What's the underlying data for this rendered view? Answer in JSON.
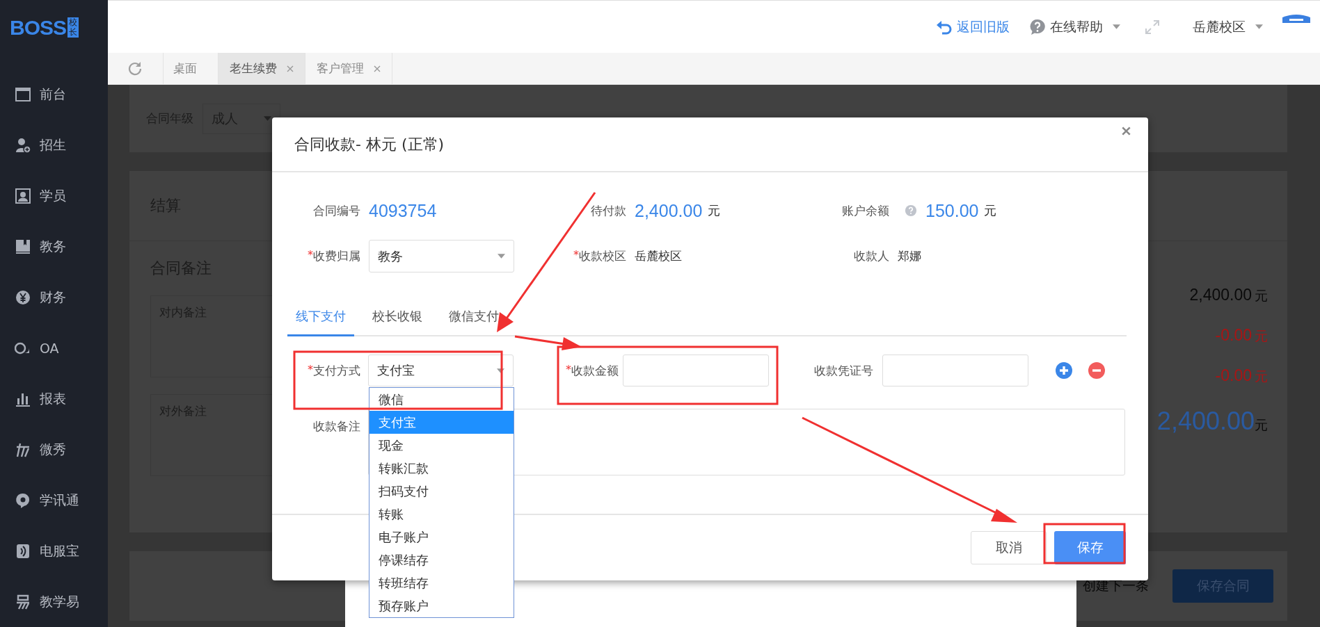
{
  "app": {
    "logo": "BOSS",
    "logo_badge": "校长"
  },
  "top_bar": {
    "back_link": "返回旧版",
    "help": "在线帮助",
    "campus": "岳麓校区"
  },
  "tabs": [
    {
      "label": "桌面",
      "selected": false,
      "closable": false
    },
    {
      "label": "老生续费",
      "selected": true,
      "closable": true
    },
    {
      "label": "客户管理",
      "selected": false,
      "closable": true
    }
  ],
  "sidebar": {
    "items": [
      {
        "label": "前台",
        "kind": "window"
      },
      {
        "label": "招生",
        "kind": "user-add"
      },
      {
        "label": "学员",
        "kind": "contact"
      },
      {
        "label": "教务",
        "kind": "book"
      },
      {
        "label": "财务",
        "kind": "yen"
      },
      {
        "label": "OA",
        "kind": "oa"
      },
      {
        "label": "报表",
        "kind": "chart"
      },
      {
        "label": "微秀",
        "kind": "strokes"
      },
      {
        "label": "学讯通",
        "kind": "pin"
      },
      {
        "label": "电服宝",
        "kind": "phone"
      },
      {
        "label": "教学易",
        "kind": "wave"
      }
    ]
  },
  "background": {
    "grade_label": "合同年级",
    "grade_value": "成人",
    "settlement_title": "结算",
    "remarks_title": "合同备注",
    "internal_remark_placeholder": "对内备注",
    "external_remark_placeholder": "对外备注",
    "amounts": [
      {
        "value": "2,400.00",
        "unit": "元",
        "kind": "normal"
      },
      {
        "value": "-0.00",
        "unit": "元",
        "kind": "negative"
      },
      {
        "value": "-0.00",
        "unit": "元",
        "kind": "negative"
      },
      {
        "value": "2,400.00",
        "unit": "元",
        "kind": "total"
      }
    ],
    "next_label": "创建下一条",
    "save_contract": "保存合同"
  },
  "dialog": {
    "title": "合同收款- 林元 (正常)",
    "info": [
      {
        "label": "合同编号",
        "value": "4093754",
        "help": false
      },
      {
        "label": "待付款",
        "value": "2,400.00",
        "unit": "元",
        "help": false
      },
      {
        "label": "账户余额",
        "value": "150.00",
        "unit": "元",
        "help": true
      }
    ],
    "fields": [
      {
        "label": "收费归属",
        "required_mark": "*",
        "value": "教务",
        "kind": "select"
      },
      {
        "label": "收款校区",
        "required_mark": "*",
        "value": "岳麓校区",
        "kind": "text"
      },
      {
        "label": "收款人",
        "value": "郑娜",
        "kind": "text"
      }
    ],
    "pay_tabs": [
      {
        "label": "线下支付",
        "selected": true
      },
      {
        "label": "校长收银",
        "selected": false
      },
      {
        "label": "微信支付",
        "selected": false
      }
    ],
    "payment": {
      "method_label": "支付方式",
      "method_mark": "*",
      "method_value": "支付宝",
      "amount_label": "收款金额",
      "amount_mark": "*",
      "voucher_label": "收款凭证号",
      "remark_label": "收款备注",
      "options": [
        {
          "label": "微信",
          "selected": false
        },
        {
          "label": "支付宝",
          "selected": true
        },
        {
          "label": "现金",
          "selected": false
        },
        {
          "label": "转账汇款",
          "selected": false
        },
        {
          "label": "扫码支付",
          "selected": false
        },
        {
          "label": "转账",
          "selected": false
        },
        {
          "label": "电子账户",
          "selected": false
        },
        {
          "label": "停课结存",
          "selected": false
        },
        {
          "label": "转班结存",
          "selected": false
        },
        {
          "label": "预存账户",
          "selected": false
        }
      ]
    },
    "cancel": "取消",
    "save": "保存"
  }
}
